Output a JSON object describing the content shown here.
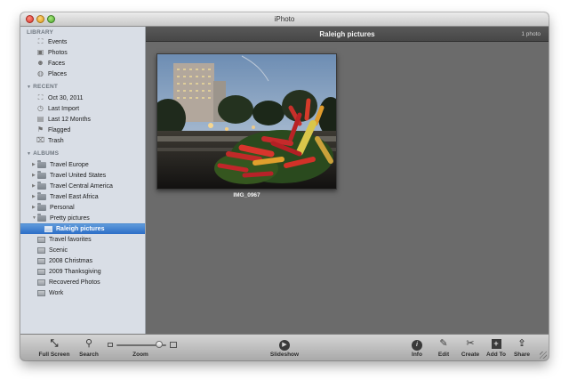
{
  "window": {
    "title": "iPhoto"
  },
  "sidebar": {
    "library": {
      "header": "LIBRARY",
      "items": [
        {
          "label": "Events",
          "icon": "events-icon"
        },
        {
          "label": "Photos",
          "icon": "photos-icon"
        },
        {
          "label": "Faces",
          "icon": "faces-icon"
        },
        {
          "label": "Places",
          "icon": "places-icon"
        }
      ]
    },
    "recent": {
      "header": "RECENT",
      "items": [
        {
          "label": "Oct 30, 2011",
          "icon": "event-icon"
        },
        {
          "label": "Last Import",
          "icon": "clock-icon"
        },
        {
          "label": "Last 12 Months",
          "icon": "calendar-icon"
        },
        {
          "label": "Flagged",
          "icon": "flag-icon"
        },
        {
          "label": "Trash",
          "icon": "trash-icon"
        }
      ]
    },
    "albums": {
      "header": "ALBUMS",
      "folders": [
        {
          "label": "Travel Europe"
        },
        {
          "label": "Travel United States"
        },
        {
          "label": "Travel Central America"
        },
        {
          "label": "Travel East Africa"
        },
        {
          "label": "Personal"
        },
        {
          "label": "Pretty pictures",
          "expanded": true
        }
      ],
      "albums": [
        {
          "label": "Raleigh pictures",
          "selected": true
        },
        {
          "label": "Travel favorites"
        },
        {
          "label": "Scenic"
        },
        {
          "label": "2008 Christmas"
        },
        {
          "label": "2009 Thanksgiving"
        },
        {
          "label": "Recovered Photos"
        },
        {
          "label": "Work"
        }
      ]
    }
  },
  "content": {
    "title": "Raleigh pictures",
    "count": "1 photo",
    "photos": [
      {
        "caption": "IMG_0967"
      }
    ]
  },
  "toolbar": {
    "fullscreen": "Full Screen",
    "search": "Search",
    "zoom": "Zoom",
    "zoom_level": 0.85,
    "slideshow": "Slideshow",
    "info": "Info",
    "edit": "Edit",
    "create": "Create",
    "add_to": "Add To",
    "share": "Share"
  },
  "colors": {
    "selection": "#2c6ec7",
    "sidebar_bg": "#d9dee6",
    "content_bg": "#6b6b6b",
    "header_bg": "#4e4e4e"
  }
}
